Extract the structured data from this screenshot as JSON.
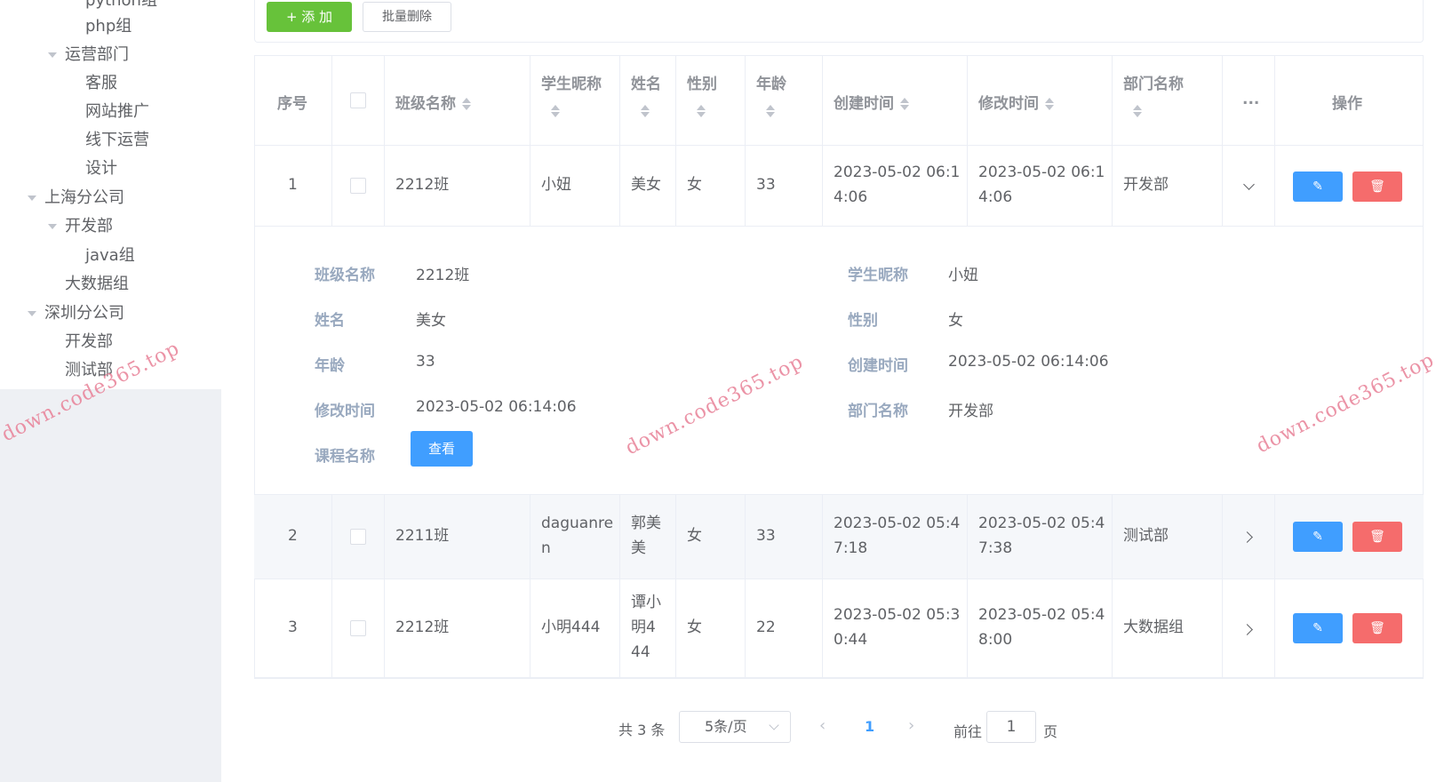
{
  "sidebar": {
    "tree": [
      {
        "label": "python组",
        "level": 3
      },
      {
        "label": "php组",
        "level": 3
      },
      {
        "label": "运营部门",
        "level": 2,
        "expanded": true
      },
      {
        "label": "客服",
        "level": 3
      },
      {
        "label": "网站推广",
        "level": 3
      },
      {
        "label": "线下运营",
        "level": 3
      },
      {
        "label": "设计",
        "level": 3
      },
      {
        "label": "上海分公司",
        "level": 1,
        "expanded": true
      },
      {
        "label": "开发部",
        "level": 2,
        "expanded": true
      },
      {
        "label": "java组",
        "level": 3
      },
      {
        "label": "大数据组",
        "level": 2
      },
      {
        "label": "深圳分公司",
        "level": 1,
        "expanded": true
      },
      {
        "label": "开发部",
        "level": 2
      },
      {
        "label": "测试部",
        "level": 2
      }
    ]
  },
  "toolbar": {
    "add_label": "+ 添 加",
    "batch_delete_label": "批量删除"
  },
  "table": {
    "headers": {
      "index": "序号",
      "class_name": "班级名称",
      "nickname": "学生昵称",
      "name": "姓名",
      "gender": "性别",
      "age": "年龄",
      "created": "创建时间",
      "modified": "修改时间",
      "dept": "部门名称",
      "more": "...",
      "ops": "操作"
    },
    "rows": [
      {
        "index": "1",
        "class_name": "2212班",
        "nickname": "小妞",
        "name": "美女",
        "gender": "女",
        "age": "33",
        "created": "2023-05-02 06:1\n4:06",
        "modified": "2023-05-02 06:1\n4:06",
        "dept": "开发部"
      },
      {
        "index": "2",
        "class_name": "2211班",
        "nickname": "daguanre\nn",
        "name": "郭美\n美",
        "gender": "女",
        "age": "33",
        "created": "2023-05-02 05:4\n7:18",
        "modified": "2023-05-02 05:4\n7:38",
        "dept": "测试部"
      },
      {
        "index": "3",
        "class_name": "2212班",
        "nickname": "小明444",
        "name": "谭小\n明4\n44",
        "gender": "女",
        "age": "22",
        "created": "2023-05-02 05:3\n0:44",
        "modified": "2023-05-02 05:4\n8:00",
        "dept": "大数据组"
      }
    ]
  },
  "detail": {
    "class_name_label": "班级名称",
    "class_name": "2212班",
    "nickname_label": "学生昵称",
    "nickname": "小妞",
    "name_label": "姓名",
    "name": "美女",
    "gender_label": "性别",
    "gender": "女",
    "age_label": "年龄",
    "age": "33",
    "created_label": "创建时间",
    "created": "2023-05-02 06:14:06",
    "modified_label": "修改时间",
    "modified": "2023-05-02 06:14:06",
    "dept_label": "部门名称",
    "dept": "开发部",
    "course_label": "课程名称",
    "view_label": "查看"
  },
  "pagination": {
    "total": "共 3 条",
    "page_size": "5条/页",
    "current": "1",
    "goto_label": "前往",
    "goto_value": "1",
    "page_unit": "页"
  },
  "watermark": "down.code365.top",
  "colors": {
    "primary": "#409eff",
    "success": "#67c23a",
    "danger": "#f56c6c"
  }
}
